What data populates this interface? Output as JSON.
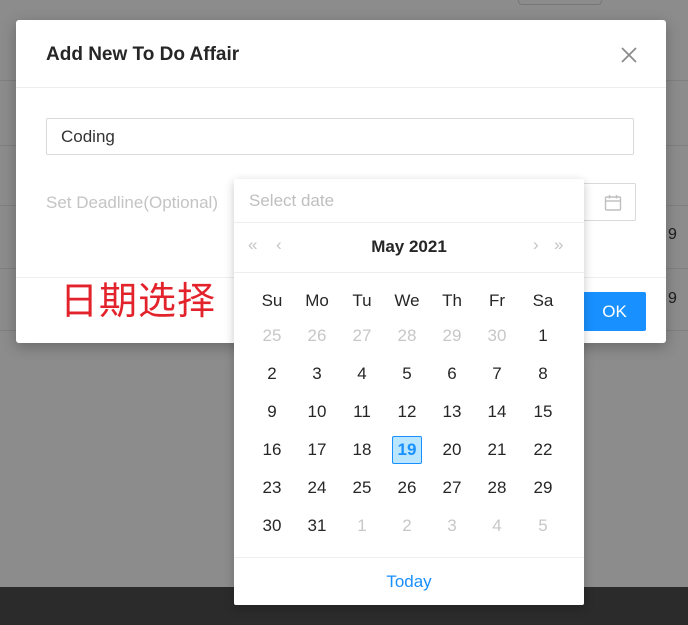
{
  "background": {
    "right_cells": [
      "9",
      "9"
    ]
  },
  "modal": {
    "title": "Add New To Do Affair",
    "close_icon": "close-icon",
    "todo_value": "Coding",
    "deadline_label": "Set Deadline(Optional)",
    "ok_label": "OK"
  },
  "annotation": "日期选择",
  "datepicker": {
    "placeholder": "Select date",
    "calendar_icon": "calendar-icon",
    "month_title": "May 2021",
    "nav": {
      "prev_year": "«",
      "prev_month": "‹",
      "next_month": "›",
      "next_year": "»"
    },
    "weekdays": [
      "Su",
      "Mo",
      "Tu",
      "We",
      "Th",
      "Fr",
      "Sa"
    ],
    "weeks": [
      [
        "25",
        "26",
        "27",
        "28",
        "29",
        "30",
        "1"
      ],
      [
        "2",
        "3",
        "4",
        "5",
        "6",
        "7",
        "8"
      ],
      [
        "9",
        "10",
        "11",
        "12",
        "13",
        "14",
        "15"
      ],
      [
        "16",
        "17",
        "18",
        "19",
        "20",
        "21",
        "22"
      ],
      [
        "23",
        "24",
        "25",
        "26",
        "27",
        "28",
        "29"
      ],
      [
        "30",
        "31",
        "1",
        "2",
        "3",
        "4",
        "5"
      ]
    ],
    "selected_day": "19",
    "today_label": "Today",
    "colors": {
      "accent": "#1890ff",
      "selected_bg": "#bae7ff",
      "annotation": "#e3232b"
    }
  }
}
